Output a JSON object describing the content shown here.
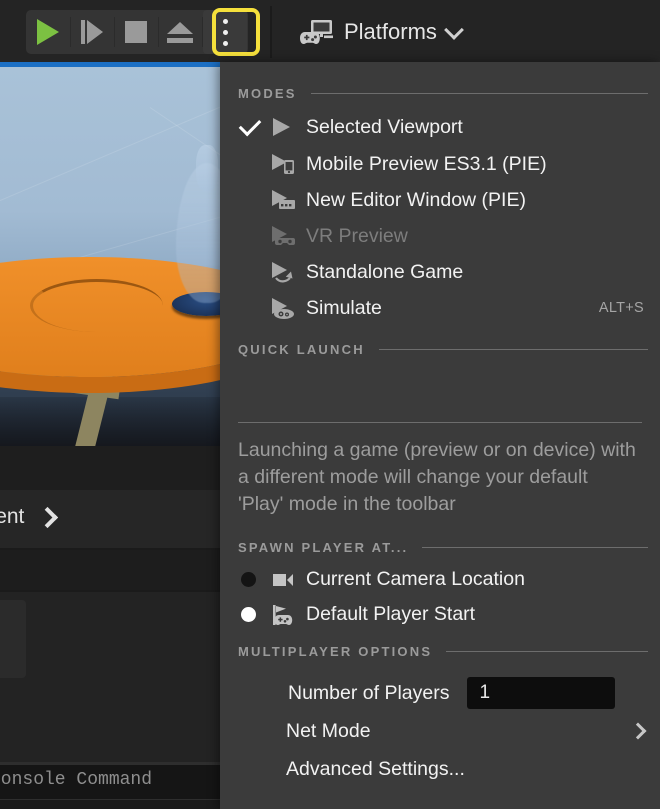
{
  "toolbar": {
    "play_button": "Play",
    "step_button": "Skip / Step Forward",
    "stop_button": "Stop",
    "eject_button": "Eject",
    "options_button": "Play Mode Options",
    "platforms_label": "Platforms",
    "highlight_color": "#f5e03c"
  },
  "background": {
    "breadcrumb_text": "ontent",
    "console_placeholder": "Console Command"
  },
  "menu": {
    "sections": {
      "modes": "MODES",
      "quick_launch": "QUICK LAUNCH",
      "spawn_player": "SPAWN PLAYER AT...",
      "multiplayer": "MULTIPLAYER OPTIONS"
    },
    "modes": [
      {
        "label": "Selected Viewport",
        "icon": "play-icon",
        "checked": true,
        "disabled": false,
        "shortcut": ""
      },
      {
        "label": "Mobile Preview ES3.1 (PIE)",
        "icon": "play-mobile-icon",
        "checked": false,
        "disabled": false,
        "shortcut": ""
      },
      {
        "label": "New Editor Window (PIE)",
        "icon": "play-window-icon",
        "checked": false,
        "disabled": false,
        "shortcut": ""
      },
      {
        "label": "VR Preview",
        "icon": "play-vr-icon",
        "checked": false,
        "disabled": true,
        "shortcut": ""
      },
      {
        "label": "Standalone Game",
        "icon": "play-standalone-icon",
        "checked": false,
        "disabled": false,
        "shortcut": ""
      },
      {
        "label": "Simulate",
        "icon": "play-simulate-icon",
        "checked": false,
        "disabled": false,
        "shortcut": "ALT+S"
      }
    ],
    "quick_launch_description": "Launching a game (preview or on device) with a different mode will change your default 'Play' mode in the toolbar",
    "spawn_options": [
      {
        "label": "Current Camera Location",
        "icon": "camera-icon",
        "selected": false
      },
      {
        "label": "Default Player Start",
        "icon": "player-start-icon",
        "selected": true
      }
    ],
    "multiplayer": {
      "players_label": "Number of Players",
      "players_value": "1",
      "net_mode_label": "Net Mode",
      "advanced_label": "Advanced Settings..."
    }
  }
}
